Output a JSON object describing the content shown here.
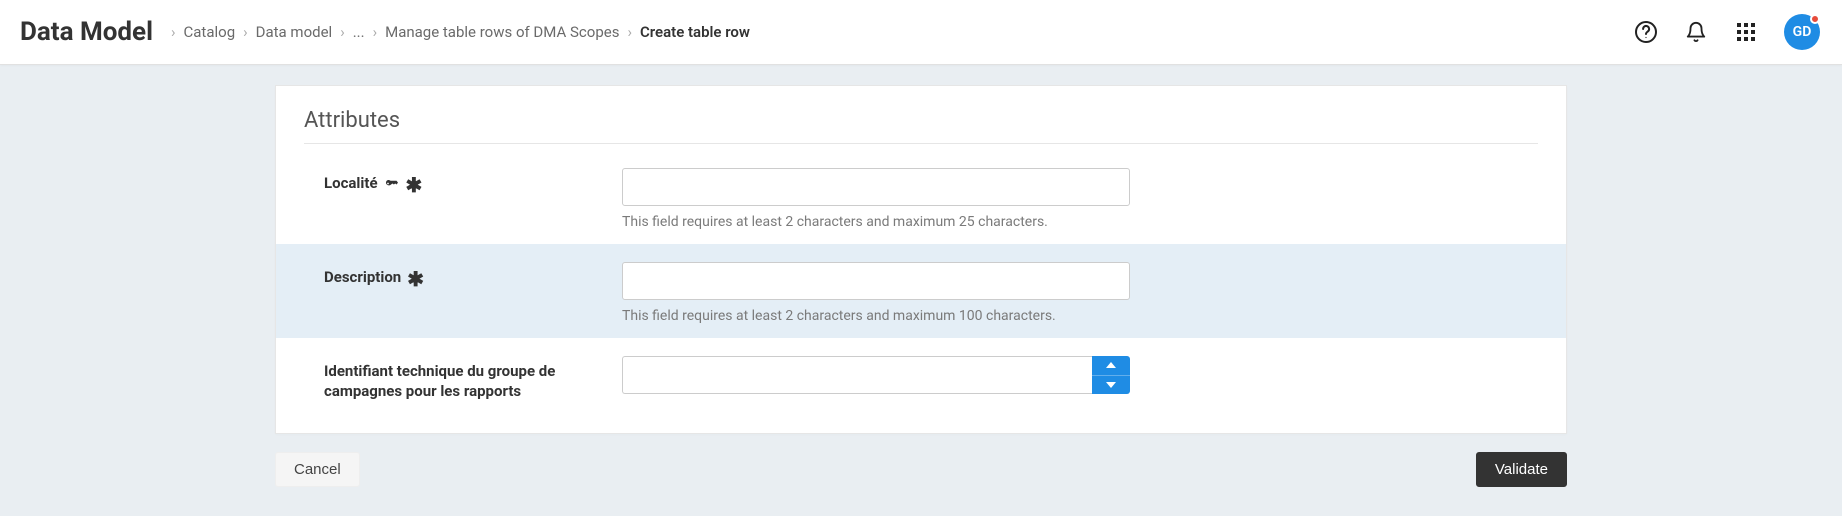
{
  "header": {
    "title": "Data Model",
    "breadcrumb": [
      "Catalog",
      "Data model",
      "...",
      "Manage table rows of DMA Scopes",
      "Create table row"
    ]
  },
  "avatar_initials": "GD",
  "panel": {
    "title": "Attributes",
    "fields": {
      "localite": {
        "label": "Localité",
        "value": "",
        "helper": "This field requires at least 2 characters and maximum 25 characters."
      },
      "description": {
        "label": "Description",
        "value": "",
        "helper": "This field requires at least 2 characters and maximum 100 characters."
      },
      "identifiant": {
        "label": "Identifiant technique du groupe de campagnes pour les rapports",
        "value": ""
      }
    }
  },
  "actions": {
    "cancel": "Cancel",
    "validate": "Validate"
  }
}
